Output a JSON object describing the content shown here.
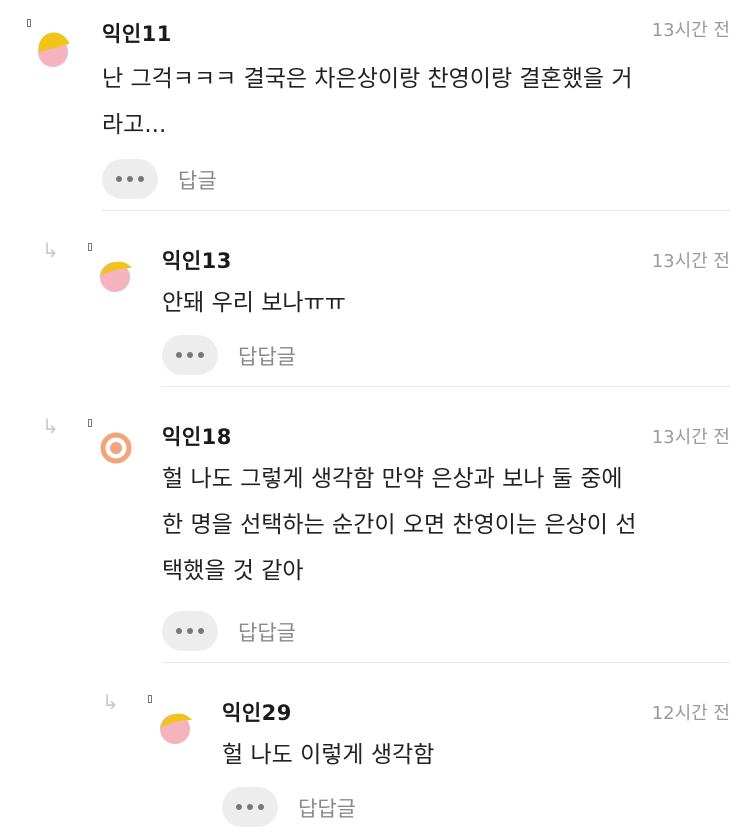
{
  "comments": [
    {
      "name": "익인11",
      "time": "13시간 전",
      "lines": [
        "난 그걱ㅋㅋㅋ 결국은 차은상이랑 찬영이랑 결혼했을 거",
        "라고..."
      ],
      "reply_label": "답글"
    },
    {
      "name": "익인13",
      "time": "13시간 전",
      "lines": [
        "안돼 우리 보나ㅠㅠ"
      ],
      "reply_label": "답답글"
    },
    {
      "name": "익인18",
      "time": "13시간 전",
      "lines": [
        "헐 나도 그렇게 생각함 만약 은상과 보나 둘 중에",
        "한 명을 선택하는 순간이 오면 찬영이는 은상이 선",
        "택했을 것 같아"
      ],
      "reply_label": "답답글"
    },
    {
      "name": "익인29",
      "time": "12시간 전",
      "lines": [
        "헐 나도 이렇게 생각함"
      ],
      "reply_label": "답답글"
    }
  ],
  "icons": {
    "reply_arrow": "reply-arrow-icon",
    "more": "more-icon",
    "avatar_moon": "moon-avatar-icon",
    "avatar_ring": "ring-avatar-icon"
  },
  "colors": {
    "avatar_yellow": "#f2c318",
    "avatar_pink": "#f4b3bd",
    "avatar_orange": "#f2a57a"
  }
}
